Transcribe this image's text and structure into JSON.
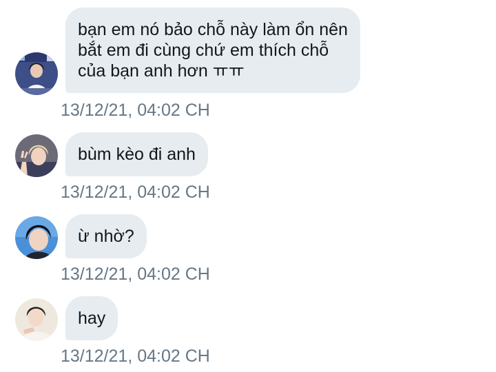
{
  "conversation": {
    "messages": [
      {
        "avatar_icon": "user-avatar-1",
        "lines": [
          "bạn em nó bảo chỗ này làm ổn nên",
          "bắt em đi cùng chứ em thích chỗ",
          "của bạn anh hơn ㅠㅠ"
        ],
        "timestamp": "13/12/21, 04:02 CH"
      },
      {
        "avatar_icon": "user-avatar-2",
        "lines": [
          "bùm kèo đi anh"
        ],
        "timestamp": "13/12/21, 04:02 CH"
      },
      {
        "avatar_icon": "user-avatar-3",
        "lines": [
          "ừ nhờ?"
        ],
        "timestamp": "13/12/21, 04:02 CH"
      },
      {
        "avatar_icon": "user-avatar-4",
        "lines": [
          "hay"
        ],
        "timestamp": "13/12/21, 04:02 CH"
      }
    ]
  },
  "colors": {
    "bubble_background": "#e6ecf0",
    "message_text": "#14171a",
    "timestamp_text": "#657786"
  }
}
